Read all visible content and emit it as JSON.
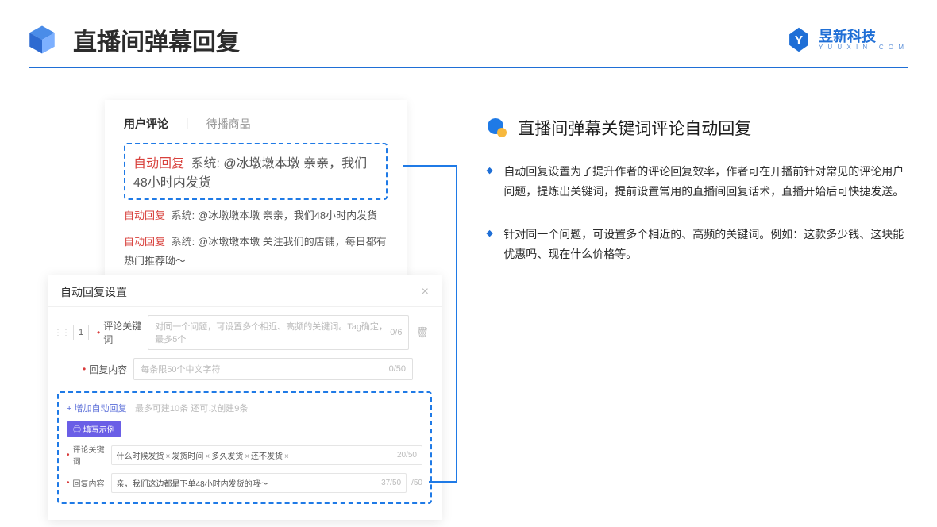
{
  "header": {
    "title": "直播间弹幕回复",
    "logo_cn": "昱新科技",
    "logo_en": "Y U U X I N . C O M"
  },
  "tabs": {
    "active": "用户评论",
    "inactive": "待播商品"
  },
  "comments": {
    "tag_autoreply": "自动回复",
    "tag_system": "系统:",
    "c1": "@冰墩墩本墩 亲亲，我们48小时内发货",
    "c2": "@冰墩墩本墩 亲亲，我们48小时内发货",
    "c3": "@冰墩墩本墩 关注我们的店铺，每日都有热门推荐呦～"
  },
  "settings": {
    "title": "自动回复设置",
    "seq": "1",
    "label_keyword": "评论关键词",
    "placeholder_keyword": "对同一个问题，可设置多个相近、高频的关键词。Tag确定，最多5个",
    "counter_keyword": "0/6",
    "label_content": "回复内容",
    "placeholder_content": "每条限50个中文字符",
    "counter_content": "0/50",
    "add_link": "+ 增加自动回复",
    "add_hint": "最多可建10条 还可以创建9条",
    "fill_badge": "◎ 填写示例",
    "ex_label_keyword": "评论关键词",
    "ex_tags": [
      "什么时候发货",
      "发货时间",
      "多久发货",
      "还不发货"
    ],
    "ex_count_keyword": "20/50",
    "ex_label_content": "回复内容",
    "ex_content_text": "亲，我们这边都是下单48小时内发货的哦～",
    "ex_count_content": "37/50",
    "ext_out": "/50"
  },
  "right": {
    "section_title": "直播间弹幕关键词评论自动回复",
    "bullet1": "自动回复设置为了提升作者的评论回复效率，作者可在开播前针对常见的评论用户问题，提炼出关键词，提前设置常用的直播间回复话术，直播开始后可快捷发送。",
    "bullet2": "针对同一个问题，可设置多个相近的、高频的关键词。例如：这款多少钱、这块能优惠吗、现在什么价格等。"
  }
}
